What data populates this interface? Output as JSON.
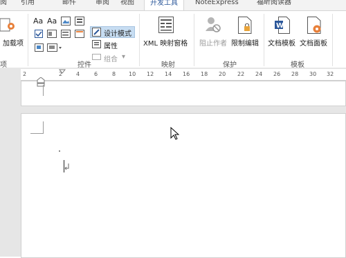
{
  "tabs": [
    {
      "label": "阅"
    },
    {
      "label": "引用"
    },
    {
      "label": "邮件"
    },
    {
      "label": "审阅"
    },
    {
      "label": "视图"
    },
    {
      "label": "开发工具"
    },
    {
      "label": "NoteExpress"
    },
    {
      "label": "福昕阅读器"
    }
  ],
  "ribbon": {
    "addins_label": "加载项",
    "design_mode": "设计模式",
    "properties": "属性",
    "group": "组合",
    "xml_map": "XML 映射窗格",
    "block_authors": "阻止作者",
    "restrict_editing": "限制编辑",
    "doc_template": "文档模板",
    "doc_panel": "文档面板",
    "groups": {
      "addins": "项",
      "controls": "控件",
      "mapping": "映射",
      "protect": "保护",
      "template": "模板"
    },
    "aa1": "Aa",
    "aa2": "Aa"
  },
  "ruler": {
    "ticks": [
      "2",
      "2",
      "4",
      "6",
      "8",
      "10",
      "12",
      "14",
      "16",
      "18",
      "20",
      "22",
      "24",
      "26",
      "28",
      "30",
      "32"
    ]
  },
  "colors": {
    "accent": "#2b579a",
    "design_active": "#c7ddf2"
  }
}
